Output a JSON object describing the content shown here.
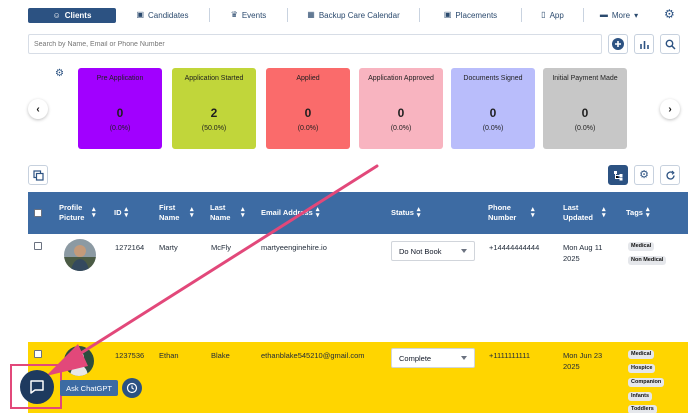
{
  "nav": {
    "tabs": [
      {
        "label": "Clients",
        "icon": "smiley-icon",
        "active": true
      },
      {
        "label": "Candidates",
        "icon": "briefcase-icon",
        "active": false
      },
      {
        "label": "Events",
        "icon": "trophy-icon",
        "active": false
      },
      {
        "label": "Backup Care Calendar",
        "icon": "calendar-icon",
        "active": false
      },
      {
        "label": "Placements",
        "icon": "briefcase-icon",
        "active": false
      },
      {
        "label": "App",
        "icon": "mobile-icon",
        "active": false
      },
      {
        "label": "More",
        "icon": "chat-icon",
        "active": false
      }
    ],
    "more_caret": "▾"
  },
  "search": {
    "placeholder": "Search by Name, Email or Phone Number"
  },
  "pipeline": {
    "cards": [
      {
        "label": "Pre Application",
        "count": "0",
        "percent": "(0.0%)",
        "color": "#a100ff",
        "text_color": "#1f1f1f"
      },
      {
        "label": "Application Started",
        "count": "2",
        "percent": "(50.0%)",
        "color": "#c1d63a",
        "text_color": "#1f1f1f"
      },
      {
        "label": "Applied",
        "count": "0",
        "percent": "(0.0%)",
        "color": "#fa6b6b",
        "text_color": "#1f1f1f"
      },
      {
        "label": "Application Approved",
        "count": "0",
        "percent": "(0.0%)",
        "color": "#f8b4c0",
        "text_color": "#1f1f1f"
      },
      {
        "label": "Documents Signed",
        "count": "0",
        "percent": "(0.0%)",
        "color": "#b9bdfb",
        "text_color": "#1f1f1f"
      },
      {
        "label": "Initial Payment Made",
        "count": "0",
        "percent": "(0.0%)",
        "color": "#c7c7c7",
        "text_color": "#1f1f1f"
      }
    ],
    "prev": "‹",
    "next": "›"
  },
  "table": {
    "columns": [
      {
        "label": "Profile Picture"
      },
      {
        "label": "ID"
      },
      {
        "label": "First Name"
      },
      {
        "label": "Last Name"
      },
      {
        "label": "Email Address"
      },
      {
        "label": "Status"
      },
      {
        "label": "Phone Number"
      },
      {
        "label": "Last Updated"
      },
      {
        "label": "Tags"
      }
    ],
    "rows": [
      {
        "id": "1272164",
        "first": "Marty",
        "last": "McFly",
        "email": "martyeenginehire.io",
        "status": "Do Not Book",
        "phone": "+14444444444",
        "updated": "Mon Aug 11 2025",
        "tags": [
          "Medical",
          "Non Medical"
        ],
        "bg": "#ffffff"
      },
      {
        "id": "1237536",
        "first": "Ethan",
        "last": "Blake",
        "email": "ethanblake545210@gmail.com",
        "status": "Complete",
        "phone": "+1111111111",
        "updated": "Mon Jun 23 2025",
        "tags": [
          "Medical",
          "Hospice",
          "Companion",
          "Infants",
          "Toddlers"
        ],
        "bg": "#ffd500"
      }
    ]
  },
  "chat": {
    "ask_label": "Ask ChatGPT"
  },
  "colors": {
    "primary": "#2c5282",
    "header": "#3d6ba3",
    "annotation": "#e2487a"
  }
}
